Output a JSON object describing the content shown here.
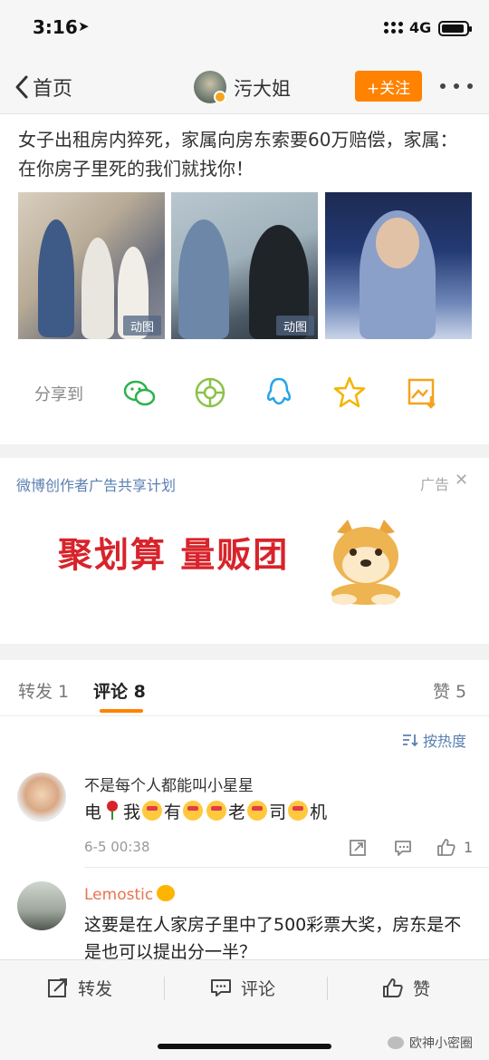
{
  "status_bar": {
    "time": "3:16",
    "network": "4G"
  },
  "nav": {
    "back_label": "首页",
    "account_name": "污大姐",
    "follow_label": "+关注"
  },
  "post": {
    "text": "女子出租房内猝死，家属向房东索要60万赔偿，家属：在你房子里死的我们就找你！",
    "images": [
      {
        "badge": "动图"
      },
      {
        "badge": "动图"
      },
      {
        "badge": ""
      }
    ]
  },
  "share": {
    "label": "分享到",
    "targets": [
      "wechat-icon",
      "moments-icon",
      "qq-icon",
      "qzone-icon",
      "save-image-icon"
    ]
  },
  "ad": {
    "plan_label": "微博创作者广告共享计划",
    "ad_tag": "广告",
    "slogan": "聚划算  量贩团"
  },
  "tabs": {
    "repost": "转发 1",
    "comments": "评论 8",
    "likes": "赞 5"
  },
  "sort_label": "按热度",
  "comments": [
    {
      "name": "不是每个人都能叫小星星",
      "text_parts": [
        "电",
        "我",
        "有",
        "老",
        "司",
        "机"
      ],
      "time": "6-5 00:38",
      "like_count": "1"
    },
    {
      "name": "Lemostic",
      "text": "这要是在人家房子里中了500彩票大奖，房东是不是也可以提出分一半？"
    }
  ],
  "bottom_bar": {
    "repost": "转发",
    "comment": "评论",
    "like": "赞"
  },
  "watermark": "欧神小密圈",
  "colors": {
    "accent": "#ff8200",
    "link": "#5b7fb1",
    "ad_red": "#d8232a"
  }
}
